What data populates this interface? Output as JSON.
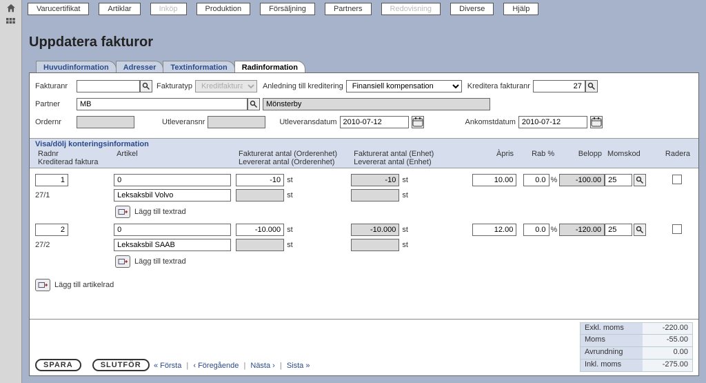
{
  "menu": {
    "items": [
      {
        "label": "Varucertifikat",
        "disabled": false
      },
      {
        "label": "Artiklar",
        "disabled": false
      },
      {
        "label": "Inköp",
        "disabled": true
      },
      {
        "label": "Produktion",
        "disabled": false
      },
      {
        "label": "Försäljning",
        "disabled": false
      },
      {
        "label": "Partners",
        "disabled": false
      },
      {
        "label": "Redovisning",
        "disabled": true
      },
      {
        "label": "Diverse",
        "disabled": false
      },
      {
        "label": "Hjälp",
        "disabled": false
      }
    ]
  },
  "page": {
    "title": "Uppdatera fakturor"
  },
  "tabs": {
    "items": [
      {
        "label": "Huvudinformation",
        "active": false
      },
      {
        "label": "Adresser",
        "active": false
      },
      {
        "label": "Textinformation",
        "active": false
      },
      {
        "label": "Radinformation",
        "active": true
      }
    ]
  },
  "form": {
    "fakturanr_label": "Fakturanr",
    "fakturanr": "",
    "fakturatyp_label": "Fakturatyp",
    "fakturatyp": "Kreditfaktura",
    "anledning_label": "Anledning till kreditering",
    "anledning": "Finansiell kompensation",
    "kreditera_label": "Kreditera fakturanr",
    "kreditera": "27",
    "partner_label": "Partner",
    "partner_code": "MB",
    "partner_name": "Mönsterby",
    "ordernr_label": "Ordernr",
    "ordernr": "",
    "utleveransnr_label": "Utleveransnr",
    "utleveransnr": "",
    "utleveransdatum_label": "Utleveransdatum",
    "utleveransdatum": "2010-07-12",
    "ankomstdatum_label": "Ankomstdatum",
    "ankomstdatum": "2010-07-12"
  },
  "grid": {
    "toggle": "Visa/dölj konteringsinformation",
    "headers": {
      "radnr": "Radnr",
      "krediterad": "Krediterad faktura",
      "artikel": "Artikel",
      "order_top": "Fakturerat antal (Orderenhet)",
      "order_bot": "Levererat antal (Orderenhet)",
      "enhet_top": "Fakturerat antal (Enhet)",
      "enhet_bot": "Levererat antal (Enhet)",
      "apris": "Àpris",
      "rab": "Rab %",
      "belopp": "Belopp",
      "momskod": "Momskod",
      "radera": "Radera"
    },
    "lagg_textrad": "Lägg till textrad",
    "lagg_artikelrad": "Lägg till artikelrad",
    "unit": "st",
    "percent": "%",
    "rows": [
      {
        "radnr": "1",
        "krediterad": "27/1",
        "artikel_nr": "0",
        "artikel_namn": "Leksaksbil Volvo",
        "fakt_order": "-10",
        "lev_order": "",
        "fakt_enhet": "-10",
        "lev_enhet": "",
        "apris": "10.00",
        "rab": "0.0",
        "belopp": "-100.00",
        "moms": "25"
      },
      {
        "radnr": "2",
        "krediterad": "27/2",
        "artikel_nr": "0",
        "artikel_namn": "Leksaksbil SAAB",
        "fakt_order": "-10.000",
        "lev_order": "",
        "fakt_enhet": "-10.000",
        "lev_enhet": "",
        "apris": "12.00",
        "rab": "0.0",
        "belopp": "-120.00",
        "moms": "25"
      }
    ]
  },
  "totals": {
    "exkl_label": "Exkl. moms",
    "exkl": "-220.00",
    "moms_label": "Moms",
    "moms": "-55.00",
    "avr_label": "Avrundning",
    "avr": "0.00",
    "inkl_label": "Inkl. moms",
    "inkl": "-275.00"
  },
  "actions": {
    "spara": "SPARA",
    "slutfor": "SLUTFÖR"
  },
  "pager": {
    "first": "« Första",
    "prev": "‹ Föregående",
    "next": "Nästa ›",
    "last": "Sista »"
  }
}
